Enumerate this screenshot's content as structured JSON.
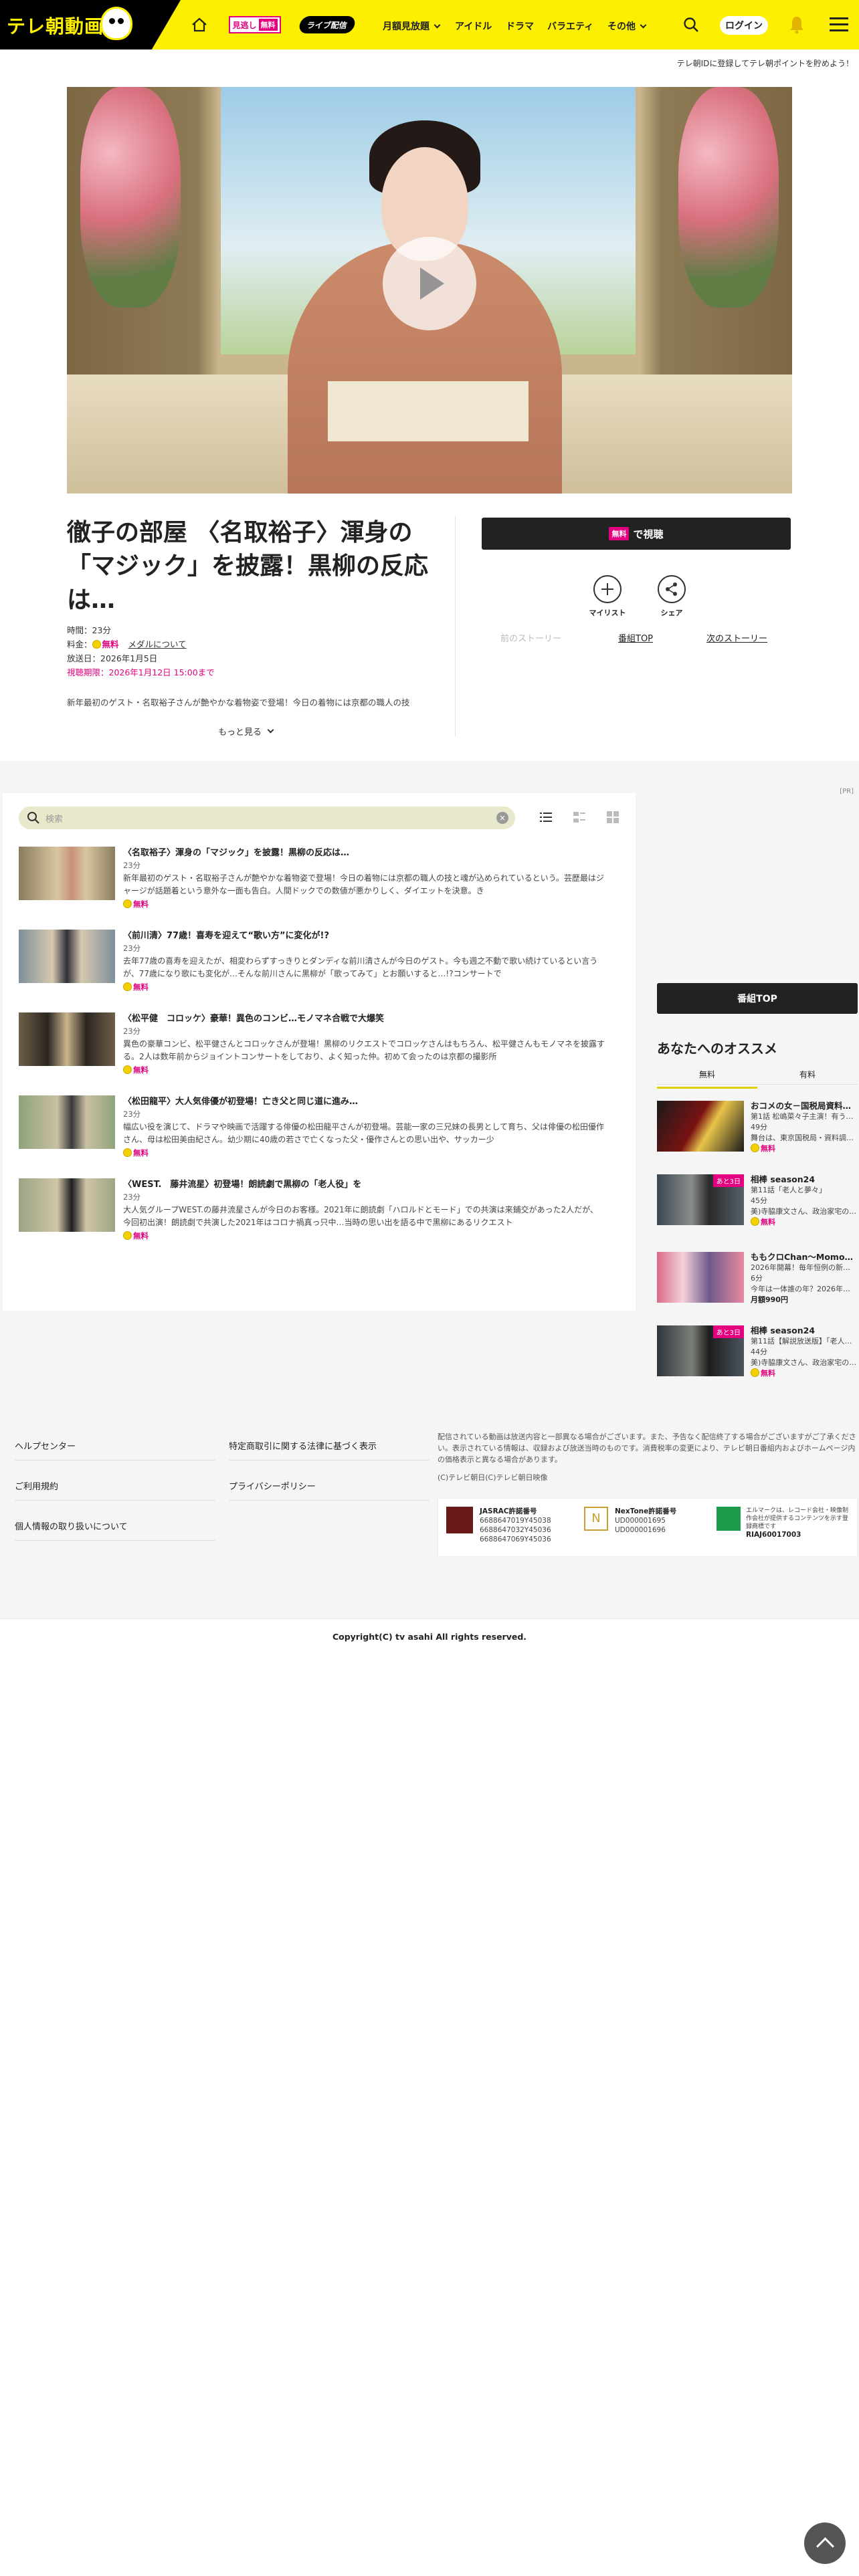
{
  "header": {
    "logo_text": "テレ朝動画",
    "badge_mitoshi": "見逃し",
    "badge_free": "無料",
    "badge_live": "ライブ配信",
    "nav": [
      "月額見放題",
      "アイドル",
      "ドラマ",
      "バラエティ",
      "その他"
    ],
    "login": "ログイン",
    "promo": "テレ朝IDに登録してテレ朝ポイントを貯めよう！"
  },
  "episode": {
    "title": "徹子の部屋 〈名取裕子〉渾身の「マジック」を披露！黒柳の反応は…",
    "duration": "時間：23分",
    "price_label": "料金：",
    "price": "無料",
    "media_link": "メダルについて",
    "air_date": "放送日：2026年1月5日",
    "limit": "視聴期限：2026年1月12日 15:00まで",
    "description": "新年最初のゲスト・名取裕子さんが艶やかな着物姿で登場！今日の着物には京都の職人の技",
    "more": "もっと見る",
    "watch_free": "無料",
    "watch_label": "で視聴",
    "mylist": "マイリスト",
    "share": "シェア",
    "prev": "前のストーリー",
    "top": "番組TOP",
    "next": "次のストーリー"
  },
  "list": {
    "search_placeholder": "検索",
    "items": [
      {
        "title": "〈名取裕子〉渾身の「マジック」を披露！黒柳の反応は…",
        "duration": "23分",
        "desc": "新年最初のゲスト・名取裕子さんが艶やかな着物姿で登場！今日の着物には京都の職人の技と魂が込められているという。芸歴最はジャージが話題着という意外な一面も告白。人間ドックでの数値が悪かりしく、ダイエットを決意。き",
        "free": "無料"
      },
      {
        "title": "〈前川清〉77歳！喜寿を迎えて“歌い方”に変化が!?",
        "duration": "23分",
        "desc": "去年77歳の喜寿を迎えたが、相変わらずすっきりとダンディな前川清さんが今日のゲスト。今も週之不動で歌い続けているとい言うが、77歳になり歌にも変化が…そんな前川さんに黒柳が「歌ってみて」とお願いすると…!?コンサートで",
        "free": "無料"
      },
      {
        "title": "〈松平健　コロッケ〉豪華！異色のコンビ…モノマネ合戦で大爆笑",
        "duration": "23分",
        "desc": "異色の豪華コンビ、松平健さんとコロッケさんが登場！黒柳のリクエストでコロッケさんはもちろん、松平健さんもモノマネを披露する。2人は数年前からジョイントコンサートをしており、よく知った仲。初めて会ったのは京都の撮影所",
        "free": "無料"
      },
      {
        "title": "〈松田龍平〉大人気俳優が初登場！亡き父と同じ道に進み…",
        "duration": "23分",
        "desc": "幅広い役を演じて、ドラマや映画で活躍する俳優の松田龍平さんが初登場。芸能一家の三兄妹の長男として育ち、父は俳優の松田優作さん、母は松田美由紀さん。幼少期に40歳の若さで亡くなった父・優作さんとの思い出や、サッカー少",
        "free": "無料"
      },
      {
        "title": "〈WEST.　藤井流星〉初登場！朗読劇で黒柳の「老人役」を",
        "duration": "23分",
        "desc": "大人気グループWEST.の藤井流星さんが今日のお客様。2021年に朗読劇「ハロルドとモード」での共演は来鋪交があった2人だが、今回初出演！朗読劇で共演した2021年はコロナ禍真っ只中…当時の思い出を語る中で黒柳にあるリクエスト",
        "free": "無料"
      }
    ]
  },
  "sidebar": {
    "program_top": "番組TOP",
    "recommend_title": "あなたへのオススメ",
    "tab_free": "無料",
    "tab_paid": "有料",
    "cards": [
      {
        "title": "おコメの女－国税局資料…",
        "sub": "第1話 松嶋菜々子主演！有う…",
        "duration": "49分",
        "desc": "舞台は、東京国税局・資料調…",
        "price": "無料",
        "tag": ""
      },
      {
        "title": "相棒 season24",
        "sub": "第11話「老人と夢々」",
        "duration": "45分",
        "desc": "美)寺脇康文さん、政治家宅の…",
        "price": "無料",
        "tag": "あと3日"
      },
      {
        "title": "ももクロChan～Momo…",
        "sub": "2026年開幕！毎年恒例の新…",
        "duration": "6分",
        "desc": "今年は一体誰の年？2026年…",
        "price": "月額990円",
        "tag": ""
      },
      {
        "title": "相棒 season24",
        "sub": "第11話【解説放送版】「老人…",
        "duration": "44分",
        "desc": "美)寺脇康文さん、政治家宅の…",
        "price": "無料",
        "tag": "あと3日"
      }
    ]
  },
  "footer": {
    "links_left": [
      "ヘルプセンター",
      "ご利用規約",
      "個人情報の取り扱いについて"
    ],
    "links_right": [
      "特定商取引に関する法律に基づく表示",
      "プライバシーポリシー"
    ],
    "note": "配信されている動画は放送内容と一部異なる場合がございます。また、予告なく配信終了する場合がございますがご了承ください。表示されている情報は、収録および放送当時のものです。消費税率の変更により、テレビ朝日番組内およびホームページ内の価格表示と異なる場合があります。",
    "credit": "(C)テレビ朝日(C)テレビ朝日映像",
    "jasrac_title": "JASRAC許諾番号",
    "jasrac_nums": [
      "6688647019Y45038",
      "6688647032Y45036",
      "6688647069Y45036"
    ],
    "nextone_title": "NexTone許諾番号",
    "nextone_nums": [
      "UD000001695",
      "UD000001696"
    ],
    "lmark_text": "エルマークは、レコード会社・映像制作会社が提供するコンテンツを示す登録商標です",
    "lmark_num": "RIAJ60017003",
    "copyright": "Copyright(C) tv asahi All rights reserved."
  }
}
